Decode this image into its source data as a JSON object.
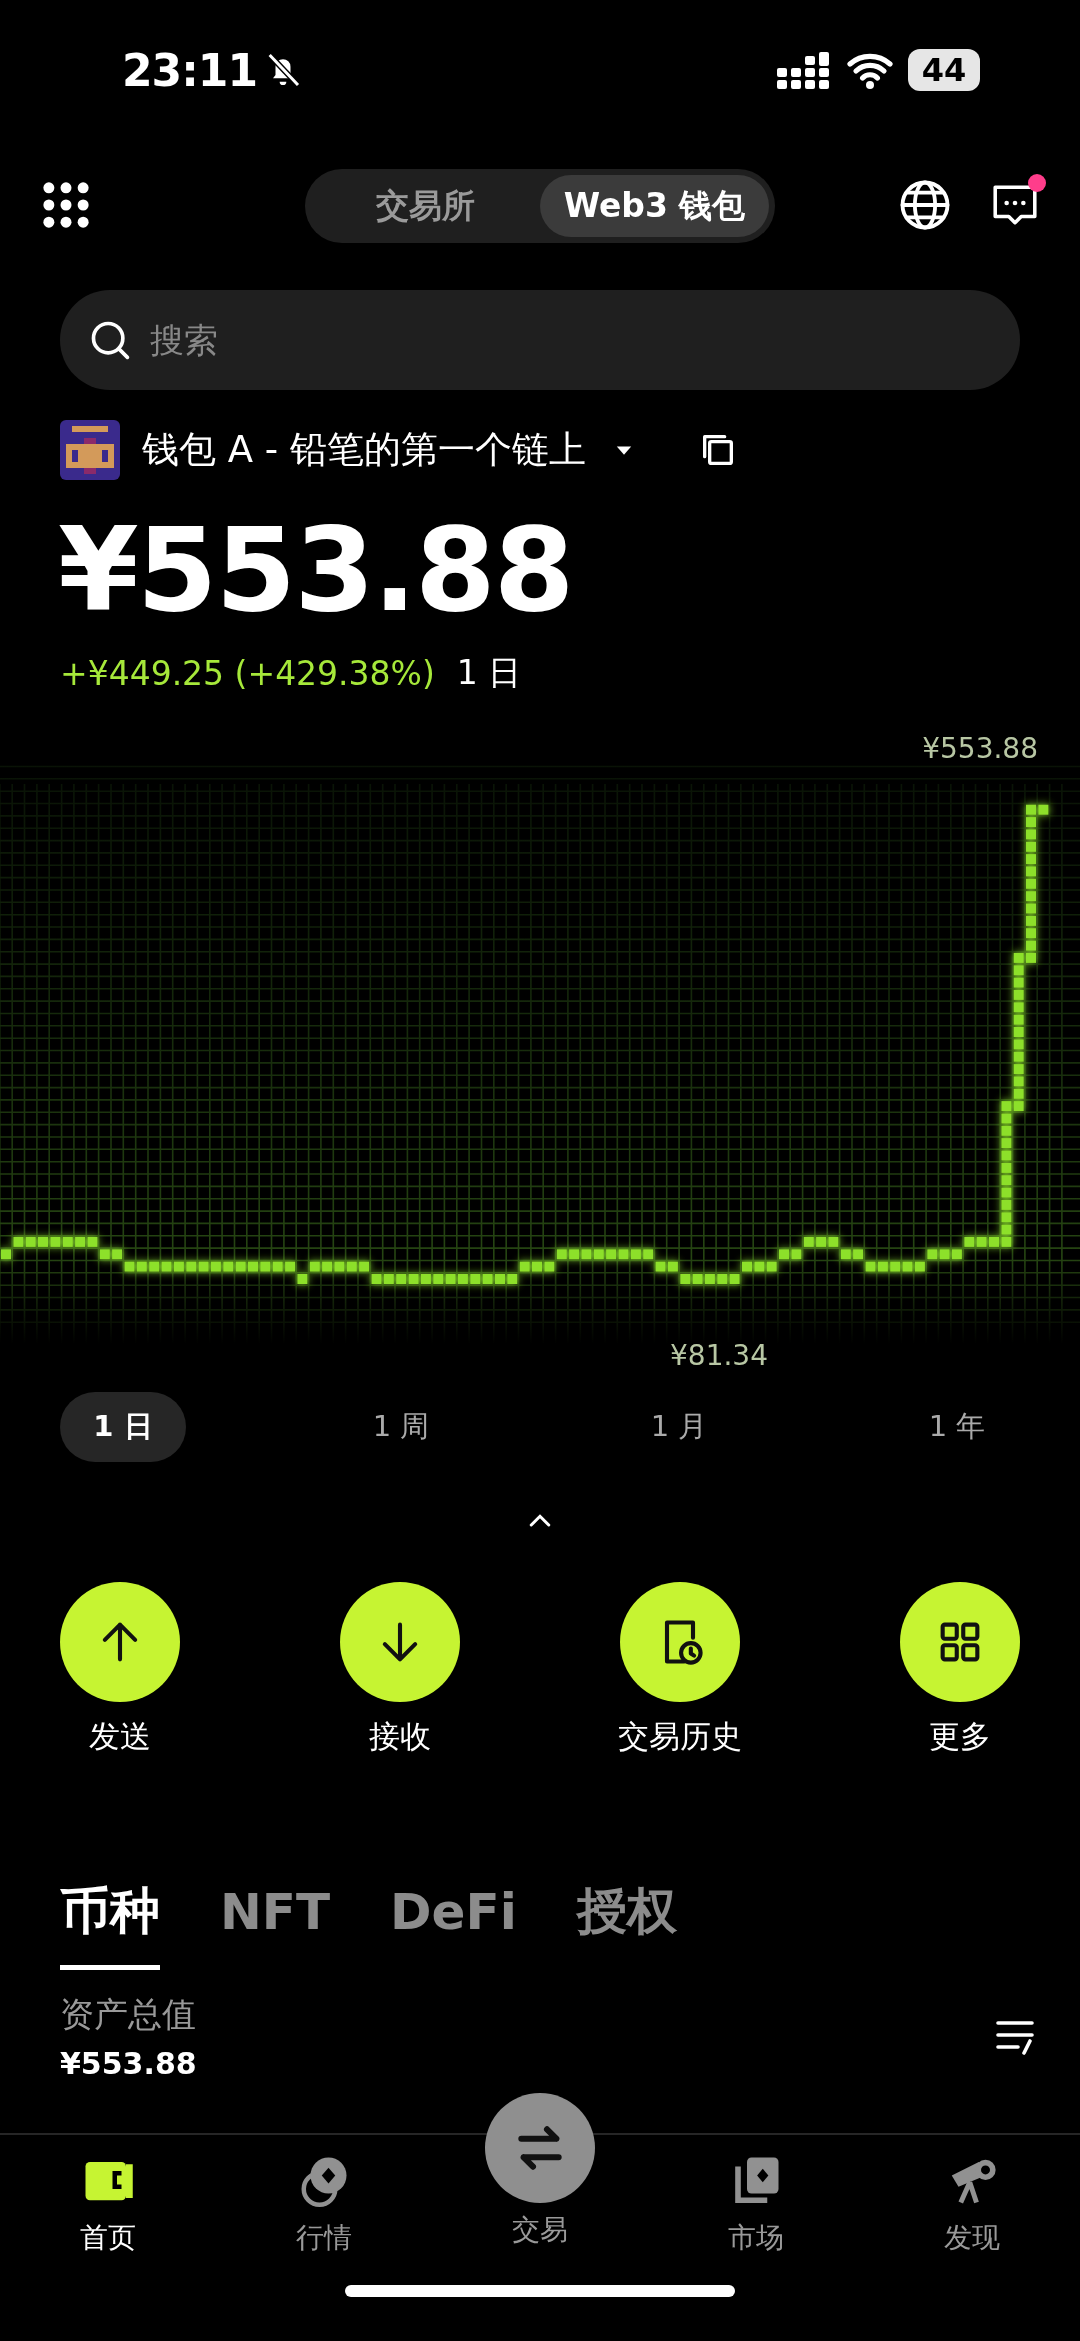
{
  "status_bar": {
    "time": "23:11",
    "battery": "44"
  },
  "header": {
    "tabs": [
      {
        "label": "交易所",
        "selected": false
      },
      {
        "label": "Web3 钱包",
        "selected": true
      }
    ],
    "messages_badge": true
  },
  "search": {
    "placeholder": "搜索"
  },
  "wallet": {
    "name": "钱包 A - 铅笔的第一个链上",
    "balance": "¥553.88",
    "change": "+¥449.25 (+429.38%)",
    "change_period": "1 日"
  },
  "chart": {
    "max_label": "¥553.88",
    "min_label": "¥81.34"
  },
  "periods": [
    {
      "label": "1 日",
      "selected": true
    },
    {
      "label": "1 周",
      "selected": false
    },
    {
      "label": "1 月",
      "selected": false
    },
    {
      "label": "1 年",
      "selected": false
    }
  ],
  "actions": [
    {
      "kind": "send",
      "label": "发送"
    },
    {
      "kind": "receive",
      "label": "接收"
    },
    {
      "kind": "history",
      "label": "交易历史"
    },
    {
      "kind": "more",
      "label": "更多"
    }
  ],
  "asset_tabs": [
    {
      "label": "币种",
      "selected": true
    },
    {
      "label": "NFT",
      "selected": false
    },
    {
      "label": "DeFi",
      "selected": false
    },
    {
      "label": "授权",
      "selected": false
    }
  ],
  "assets": {
    "total_label": "资产总值",
    "total_value": "¥553.88"
  },
  "nav": [
    {
      "kind": "home",
      "label": "首页",
      "selected": true
    },
    {
      "kind": "market",
      "label": "行情",
      "selected": false
    },
    {
      "kind": "trade",
      "label": "交易",
      "selected": false
    },
    {
      "kind": "store",
      "label": "市场",
      "selected": false
    },
    {
      "kind": "discover",
      "label": "发现",
      "selected": false
    }
  ]
}
